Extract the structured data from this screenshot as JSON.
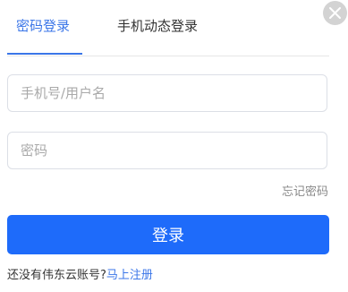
{
  "tabs": {
    "password_login": "密码登录",
    "phone_login": "手机动态登录"
  },
  "form": {
    "username_placeholder": "手机号/用户名",
    "username_value": "",
    "password_placeholder": "密码",
    "password_value": "",
    "forgot_password": "忘记密码",
    "login_button": "登录"
  },
  "footer": {
    "no_account_text": "还没有伟东云账号?",
    "register_link": "马上注册"
  },
  "colors": {
    "accent": "#3b76e8",
    "button": "#1e6bfa",
    "close_bg": "#d3d3d3"
  },
  "icons": {
    "close": "close-icon"
  }
}
